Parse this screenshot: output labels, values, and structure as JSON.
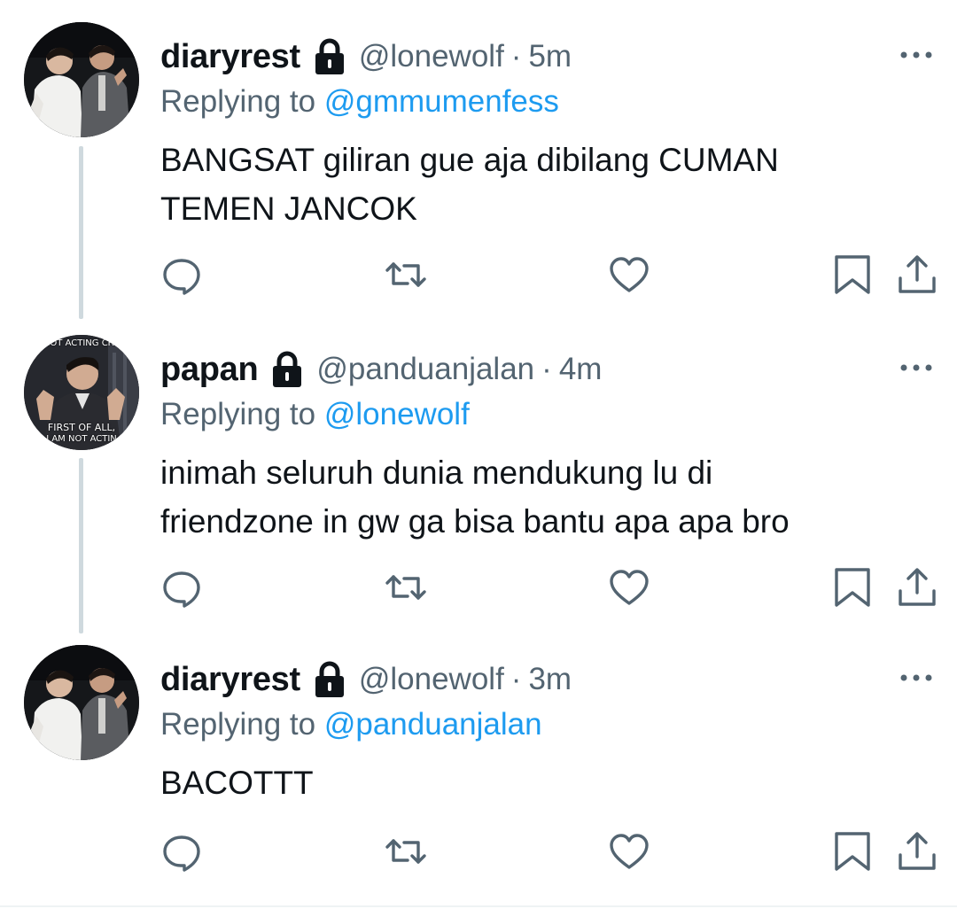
{
  "tweets": [
    {
      "name": "diaryrest",
      "handle": "@lonewolf",
      "separator": "·",
      "time": "5m",
      "replying_prefix": "Replying to",
      "replying_to": "@gmmumenfess",
      "text_lines": [
        "BANGSAT giliran gue aja dibilang CUMAN",
        "TEMEN JANCOK"
      ],
      "avatar": "two-men-photo"
    },
    {
      "name": "papan",
      "handle": "@panduanjalan",
      "separator": "·",
      "time": "4m",
      "replying_prefix": "Replying to",
      "replying_to": "@lonewolf",
      "text_lines": [
        "inimah seluruh dunia mendukung lu di",
        "friendzone in gw ga bisa bantu apa apa bro"
      ],
      "avatar": "meme-photo",
      "avatar_text_top": "NOT ACTING CRA",
      "avatar_text_bottom_1": "FIRST OF ALL,",
      "avatar_text_bottom_2": "I AM NOT ACTIN"
    },
    {
      "name": "diaryrest",
      "handle": "@lonewolf",
      "separator": "·",
      "time": "3m",
      "replying_prefix": "Replying to",
      "replying_to": "@panduanjalan",
      "text_lines": [
        "BACOTTT"
      ],
      "avatar": "two-men-photo"
    }
  ],
  "icons": {
    "lock": "lock-icon",
    "more": "more-icon",
    "reply": "reply-icon",
    "retweet": "retweet-icon",
    "like": "like-icon",
    "bookmark": "bookmark-icon",
    "share": "share-icon"
  },
  "colors": {
    "link": "#1d9bf0",
    "secondary": "#536471",
    "text": "#0f1419",
    "thread_line": "#cfd9de"
  }
}
